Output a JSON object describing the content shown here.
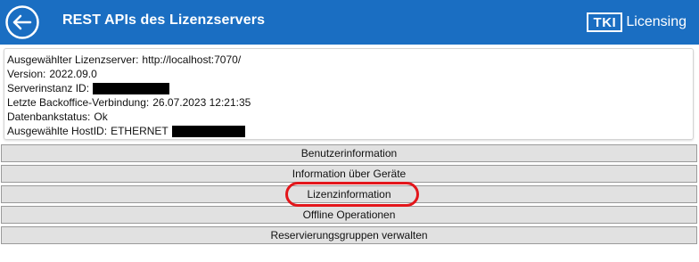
{
  "header": {
    "title": "REST APIs des Lizenzservers",
    "brand_logo": "TKI",
    "brand_text": "Licensing",
    "background": "#1a6ec2"
  },
  "info": {
    "server_label": "Ausgewählter Lizenzserver:",
    "server_value": "http://localhost:7070/",
    "version_label": "Version:",
    "version_value": "2022.09.0",
    "instance_label": "Serverinstanz ID:",
    "backoffice_label": "Letzte Backoffice-Verbindung:",
    "backoffice_value": "26.07.2023 12:21:35",
    "db_label": "Datenbankstatus:",
    "db_value": "Ok",
    "hostid_label": "Ausgewählte HostID:",
    "hostid_value": "ETHERNET"
  },
  "buttons": {
    "user_info": "Benutzerinformation",
    "device_info": "Information über Geräte",
    "license_info": "Lizenzinformation",
    "offline_ops": "Offline Operationen",
    "reservation_groups": "Reservierungsgruppen verwalten"
  },
  "icons": {
    "back": "arrow-left-circle-icon"
  },
  "colors": {
    "highlight": "#e3161b",
    "button_bg": "#e1e1e1"
  }
}
